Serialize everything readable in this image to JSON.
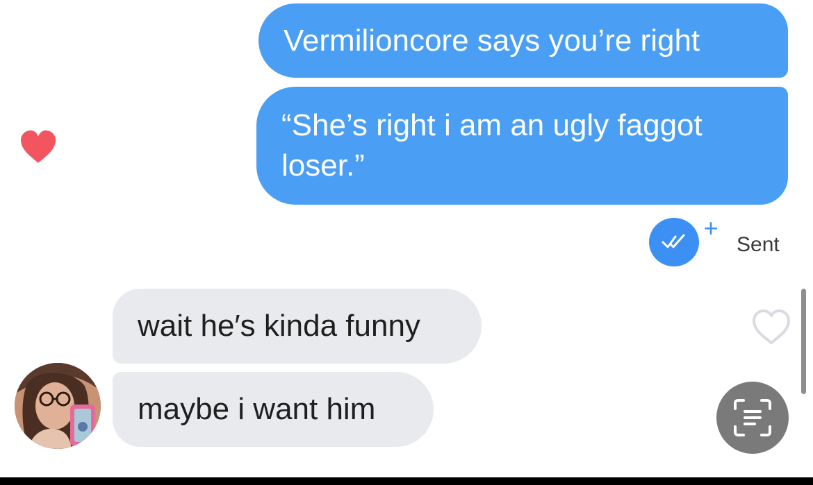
{
  "messages": {
    "outgoing": [
      {
        "text": "Vermilioncore says you’re right"
      },
      {
        "text": "“She’s right i am an ugly faggot loser.”"
      }
    ],
    "incoming": [
      {
        "text": "wait he′s kinda funny"
      },
      {
        "text": "maybe i want him"
      }
    ]
  },
  "status": {
    "plus": "+",
    "sent_label": "Sent"
  },
  "icons": {
    "reaction": "heart-icon",
    "like": "heart-outline-icon",
    "read_receipt": "double-check-icon",
    "scan": "text-scan-icon"
  },
  "colors": {
    "outgoing_bubble": "#4a9ff5",
    "incoming_bubble": "#e9eaee",
    "reaction_heart": "#f2555f",
    "read_badge": "#3c8ff3",
    "scan_button": "#7a7a7a"
  }
}
